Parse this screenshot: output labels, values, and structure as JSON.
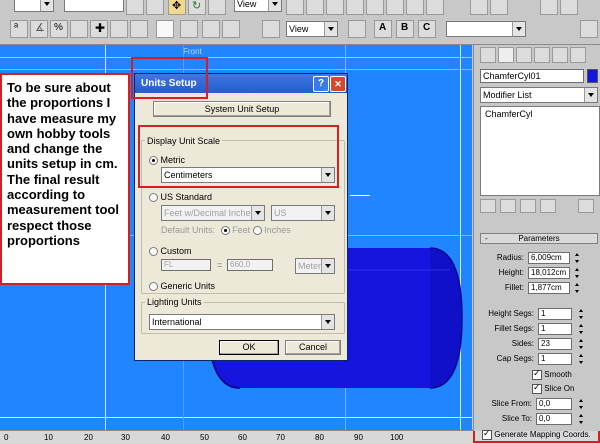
{
  "toolbar": {
    "view_select": "View",
    "view_select_2": "View",
    "named_selection": ""
  },
  "viewport": {
    "label": "Front",
    "ruler_ticks": [
      "0",
      "10",
      "20",
      "30",
      "40",
      "50",
      "60",
      "70",
      "80",
      "90",
      "100"
    ]
  },
  "annotation": {
    "text": "To be sure about the proportions I have measure my own hobby tools and change the units setup in cm. The final result according to measurement tool respect those proportions"
  },
  "dialog": {
    "title": "Units Setup",
    "help": "?",
    "close": "✕",
    "system_unit_button": "System Unit Setup",
    "display_group": "Display Unit Scale",
    "metric_label": "Metric",
    "metric_value": "Centimeters",
    "us_label": "US Standard",
    "us_value": "Feet w/Decimal Inches",
    "us_sub": "US",
    "default_units_label": "Default Units:",
    "feet_label": "Feet",
    "inches_label": "Inches",
    "custom_label": "Custom",
    "custom_name": "FL",
    "custom_eq": "=",
    "custom_value": "660,0",
    "custom_unit": "Meters",
    "generic_label": "Generic Units",
    "lighting_group": "Lighting Units",
    "lighting_value": "International",
    "ok": "OK",
    "cancel": "Cancel"
  },
  "panel": {
    "object_name": "ChamferCyl01",
    "modifier_list": "Modifier List",
    "stack_item": "ChamferCyl",
    "rollout_title": "Parameters",
    "rollout_toggle": "-",
    "params": [
      {
        "label": "Radius:",
        "value": "6,009cm"
      },
      {
        "label": "Height:",
        "value": "18,012cm"
      },
      {
        "label": "Fillet:",
        "value": "1,877cm"
      }
    ],
    "segs": [
      {
        "label": "Height Segs:",
        "value": "1"
      },
      {
        "label": "Fillet Segs:",
        "value": "1"
      },
      {
        "label": "Sides:",
        "value": "23"
      },
      {
        "label": "Cap Segs:",
        "value": "1"
      }
    ],
    "smooth_label": "Smooth",
    "slice_on_label": "Slice On",
    "slice_from_label": "Slice From:",
    "slice_from_value": "0,0",
    "slice_to_label": "Slice To:",
    "slice_to_value": "0,0",
    "mapping_label": "Generate Mapping Coords."
  },
  "colors": {
    "viewport_bg": "#1f86ff",
    "cylinder": "#1515e0",
    "highlight": "#d42020",
    "dialog_title": "#3168d6"
  }
}
